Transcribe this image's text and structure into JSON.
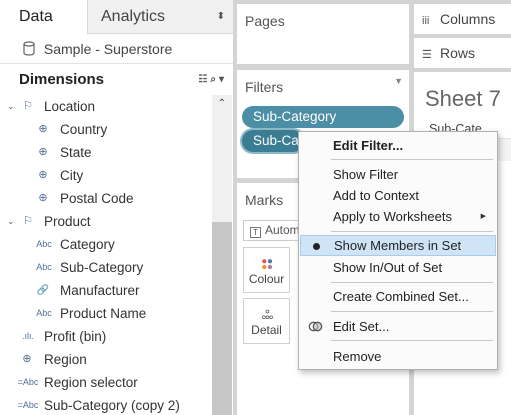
{
  "tabs": {
    "data": "Data",
    "analytics": "Analytics"
  },
  "datasource": {
    "name": "Sample - Superstore"
  },
  "dimensions": {
    "title": "Dimensions",
    "items": [
      {
        "label": "Location",
        "icon": "hierarchy-icon",
        "glyph": "⚐"
      },
      {
        "label": "Country",
        "icon": "globe-icon",
        "glyph": "⊕"
      },
      {
        "label": "State",
        "icon": "globe-icon",
        "glyph": "⊕"
      },
      {
        "label": "City",
        "icon": "globe-icon",
        "glyph": "⊕"
      },
      {
        "label": "Postal Code",
        "icon": "globe-icon",
        "glyph": "⊕"
      },
      {
        "label": "Product",
        "icon": "hierarchy-icon",
        "glyph": "⚐"
      },
      {
        "label": "Category",
        "icon": "string-icon",
        "glyph": "Abc"
      },
      {
        "label": "Sub-Category",
        "icon": "string-icon",
        "glyph": "Abc"
      },
      {
        "label": "Manufacturer",
        "icon": "group-icon",
        "glyph": "🔗"
      },
      {
        "label": "Product Name",
        "icon": "string-icon",
        "glyph": "Abc"
      },
      {
        "label": "Profit (bin)",
        "icon": "bin-icon",
        "glyph": ".ılı."
      },
      {
        "label": "Region",
        "icon": "globe-icon",
        "glyph": "⊕"
      },
      {
        "label": "Region selector",
        "icon": "calc-string-icon",
        "glyph": "=Abc"
      },
      {
        "label": "Sub-Category (copy 2)",
        "icon": "calc-string-icon",
        "glyph": "=Abc"
      }
    ]
  },
  "pages": {
    "title": "Pages"
  },
  "filters": {
    "title": "Filters",
    "pill1": "Sub-Category",
    "pill2": "Sub-Ca"
  },
  "marks": {
    "title": "Marks",
    "type": "Autom",
    "colour": "Colour",
    "detail": "Detail"
  },
  "shelves": {
    "columns": "Columns",
    "rows": "Rows"
  },
  "sheet": {
    "title": "Sheet 7",
    "subtitle": "Sub-Cate"
  },
  "menu": {
    "edit_filter": "Edit Filter...",
    "show_filter": "Show Filter",
    "add_to_context": "Add to Context",
    "apply_to_worksheets": "Apply to Worksheets",
    "show_members_in_set": "Show Members in Set",
    "show_in_out_of_set": "Show In/Out of Set",
    "create_combined_set": "Create Combined Set...",
    "edit_set": "Edit Set...",
    "remove": "Remove"
  },
  "colors": {
    "pill": "#4b8ea6",
    "pill_active": "#3b7d93",
    "menu_highlight": "#cfe4f7"
  }
}
